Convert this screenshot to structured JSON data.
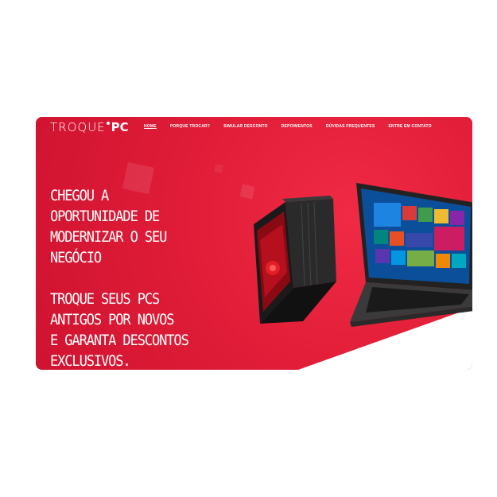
{
  "brand": {
    "part1": "TROQUE",
    "part2": "PC"
  },
  "nav": [
    {
      "label": "HOME",
      "active": true
    },
    {
      "label": "PORQUE TROCAR?"
    },
    {
      "label": "SIMULAR DESCONTO"
    },
    {
      "label": "DEPOIMENTOS"
    },
    {
      "label": "DÚVIDAS FREQUENTES"
    },
    {
      "label": "ENTRE EM CONTATO"
    }
  ],
  "hero": {
    "lines1": [
      "CHEGOU A",
      "OPORTUNIDADE DE",
      "MODERNIZAR O SEU",
      "NEGÓCIO"
    ],
    "lines2": [
      "TROQUE SEUS PCS",
      "ANTIGOS POR NOVOS",
      "E GARANTA DESCONTOS",
      "EXCLUSIVOS."
    ]
  },
  "colors": {
    "hero_red": "#e11d38",
    "text": "#ffffff"
  },
  "images": {
    "desktop": "gaming-desktop-tower",
    "laptop": "laptop-windows-10"
  }
}
